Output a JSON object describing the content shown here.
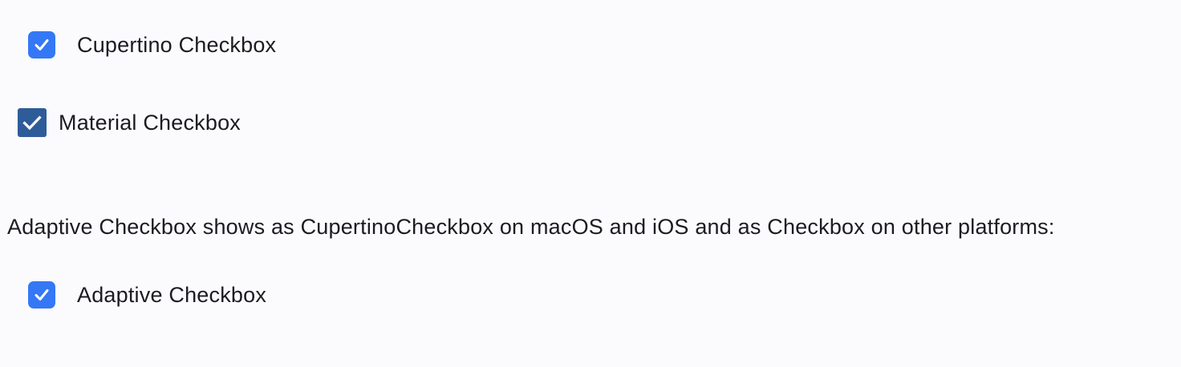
{
  "colors": {
    "background": "#fbfbfe",
    "cupertino_accent": "#3478f6",
    "material_accent": "#2e5c99",
    "check": "#ffffff",
    "text": "#1d1b20"
  },
  "checkboxes": {
    "cupertino": {
      "label": "Cupertino Checkbox",
      "checked": true,
      "icon": "checkmark-icon"
    },
    "material": {
      "label": "Material Checkbox",
      "checked": true,
      "icon": "checkmark-icon"
    },
    "adaptive": {
      "label": "Adaptive Checkbox",
      "checked": true,
      "icon": "checkmark-icon"
    }
  },
  "info": {
    "text": "Adaptive Checkbox shows as CupertinoCheckbox on macOS and iOS and as Checkbox on other platforms:"
  }
}
